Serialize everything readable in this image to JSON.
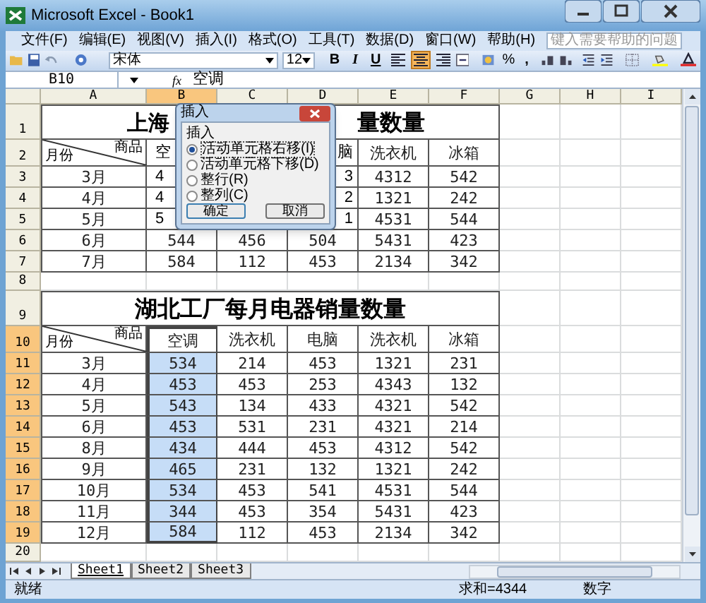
{
  "window": {
    "title": "Microsoft Excel - Book1"
  },
  "menu": [
    "文件(F)",
    "编辑(E)",
    "视图(V)",
    "插入(I)",
    "格式(O)",
    "工具(T)",
    "数据(D)",
    "窗口(W)",
    "帮助(H)"
  ],
  "help_box": {
    "placeholder": "键入需要帮助的问题"
  },
  "toolbar": {
    "font": "宋体",
    "size": "12",
    "bold": "B",
    "italic": "I",
    "underline": "U",
    "percent": "%",
    "comma": ",",
    "align": [
      {
        "kind": "left",
        "selected": false
      },
      {
        "kind": "center",
        "selected": true
      },
      {
        "kind": "right",
        "selected": false
      }
    ]
  },
  "formula_bar": {
    "name_box": "B10",
    "fx": "fx",
    "value": "空调"
  },
  "columns": [
    {
      "label": "A",
      "selected": false
    },
    {
      "label": "B",
      "selected": true
    },
    {
      "label": "C",
      "selected": false
    },
    {
      "label": "D",
      "selected": false
    },
    {
      "label": "E",
      "selected": false
    },
    {
      "label": "F",
      "selected": false
    },
    {
      "label": "G",
      "selected": false
    },
    {
      "label": "H",
      "selected": false
    },
    {
      "label": "I",
      "selected": false
    }
  ],
  "rows": [
    {
      "header": "1",
      "selected": false,
      "kind": "title",
      "title": [
        "上海",
        "量数量"
      ]
    },
    {
      "header": "2",
      "selected": false,
      "kind": "header",
      "cells": [
        {
          "kind": "diagonal",
          "left": "月份",
          "right": "商品"
        },
        {
          "kind": "cut_left",
          "text": "空"
        },
        null,
        {
          "kind": "cut_right",
          "text": "脑"
        },
        "洗衣机",
        "冰箱"
      ]
    },
    {
      "header": "3",
      "selected": false,
      "kind": "data",
      "cells": [
        "3月",
        {
          "kind": "cut_left",
          "text": "4"
        },
        null,
        {
          "kind": "cut_right",
          "text": "3"
        },
        "4312",
        "542"
      ]
    },
    {
      "header": "4",
      "selected": false,
      "kind": "data",
      "cells": [
        "4月",
        {
          "kind": "cut_left",
          "text": "4"
        },
        null,
        {
          "kind": "cut_right",
          "text": "2"
        },
        "1321",
        "242"
      ]
    },
    {
      "header": "5",
      "selected": false,
      "kind": "data",
      "cells": [
        "5月",
        {
          "kind": "cut_left",
          "text": "5"
        },
        null,
        {
          "kind": "cut_right",
          "text": "1"
        },
        "4531",
        "544"
      ]
    },
    {
      "header": "6",
      "selected": false,
      "kind": "data",
      "cells": [
        "6月",
        "544",
        "456",
        "504",
        "5431",
        "423"
      ]
    },
    {
      "header": "7",
      "selected": false,
      "kind": "data",
      "cells": [
        "7月",
        "584",
        "112",
        "453",
        "2134",
        "342"
      ]
    },
    {
      "header": "8",
      "selected": false,
      "kind": "empty"
    },
    {
      "header": "9",
      "selected": false,
      "kind": "title",
      "title": [
        "湖北工厂每月电器销量数量"
      ]
    },
    {
      "header": "10",
      "selected": true,
      "kind": "header",
      "cells": [
        {
          "kind": "diagonal",
          "left": "月份",
          "right": "商品"
        },
        "空调",
        "洗衣机",
        "电脑",
        "洗衣机",
        "冰箱"
      ]
    },
    {
      "header": "11",
      "selected": true,
      "kind": "data",
      "cells": [
        "3月",
        "534",
        "214",
        "453",
        "1321",
        "231"
      ]
    },
    {
      "header": "12",
      "selected": true,
      "kind": "data",
      "cells": [
        "4月",
        "453",
        "453",
        "253",
        "4343",
        "132"
      ]
    },
    {
      "header": "13",
      "selected": true,
      "kind": "data",
      "cells": [
        "5月",
        "543",
        "134",
        "433",
        "4321",
        "542"
      ]
    },
    {
      "header": "14",
      "selected": true,
      "kind": "data",
      "cells": [
        "6月",
        "453",
        "531",
        "231",
        "4321",
        "214"
      ]
    },
    {
      "header": "15",
      "selected": true,
      "kind": "data",
      "cells": [
        "8月",
        "434",
        "444",
        "453",
        "4312",
        "542"
      ]
    },
    {
      "header": "16",
      "selected": true,
      "kind": "data",
      "cells": [
        "9月",
        "465",
        "231",
        "132",
        "1321",
        "242"
      ]
    },
    {
      "header": "17",
      "selected": true,
      "kind": "data",
      "cells": [
        "10月",
        "534",
        "453",
        "541",
        "4531",
        "544"
      ]
    },
    {
      "header": "18",
      "selected": true,
      "kind": "data",
      "cells": [
        "11月",
        "344",
        "453",
        "354",
        "5431",
        "423"
      ]
    },
    {
      "header": "19",
      "selected": true,
      "kind": "data",
      "cells": [
        "12月",
        "584",
        "112",
        "453",
        "2134",
        "342"
      ]
    },
    {
      "header": "20",
      "selected": false,
      "kind": "empty"
    }
  ],
  "dialog": {
    "title": "插入",
    "group": "插入",
    "options": [
      {
        "label": "活动单元格右移(I)",
        "selected": true
      },
      {
        "label": "活动单元格下移(D)",
        "selected": false
      },
      {
        "label": "整行(R)",
        "selected": false
      },
      {
        "label": "整列(C)",
        "selected": false
      }
    ],
    "buttons": [
      "确定",
      "取消"
    ]
  },
  "sheet_tabs": [
    {
      "label": "Sheet1",
      "selected": true
    },
    {
      "label": "Sheet2",
      "selected": false
    },
    {
      "label": "Sheet3",
      "selected": false
    }
  ],
  "status_bar": {
    "state": "就绪",
    "sum": "求和=4344",
    "mode": "数字"
  }
}
